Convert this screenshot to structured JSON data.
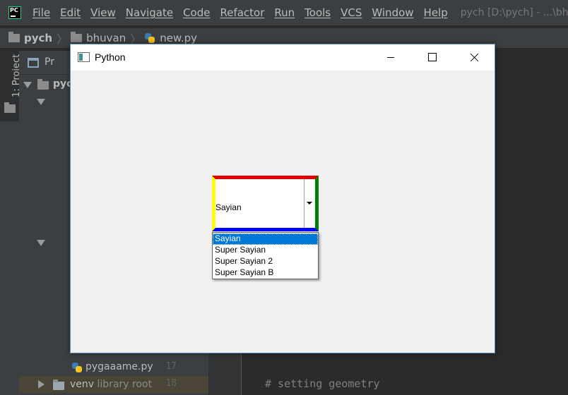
{
  "menubar": {
    "items": [
      "File",
      "Edit",
      "View",
      "Navigate",
      "Code",
      "Refactor",
      "Run",
      "Tools",
      "VCS",
      "Window",
      "Help"
    ],
    "window_title": "pych [D:\\pych] - ...\\bhuvan\\"
  },
  "breadcrumb": {
    "project": "pych",
    "folder": "bhuvan",
    "file": "new.py"
  },
  "tool_stripe": {
    "project_tab": "1: Project"
  },
  "project_panel": {
    "header": "Pr",
    "root": "pyc",
    "tree_files": [
      {
        "name": "pygaaame.py"
      },
      {
        "name": "venv",
        "hint": "library root"
      }
    ]
  },
  "gutter": {
    "line_numbers": [
      "17",
      "18"
    ]
  },
  "editor": {
    "comment": "# setting geometry"
  },
  "tk_window": {
    "title": "Python",
    "combobox": {
      "value": "Sayian",
      "colors": {
        "top": "#e00000",
        "left": "#ffff00",
        "right": "#008000",
        "bottom": "#0000ff"
      }
    },
    "dropdown": {
      "options": [
        "Sayian",
        "Super Sayian",
        "Super Sayian 2",
        "Super Sayian B"
      ],
      "selected_index": 0
    }
  },
  "colors": {
    "ide_background": "#2b2b2b",
    "ide_panel": "#3c3f41",
    "selection": "#0078d7"
  }
}
